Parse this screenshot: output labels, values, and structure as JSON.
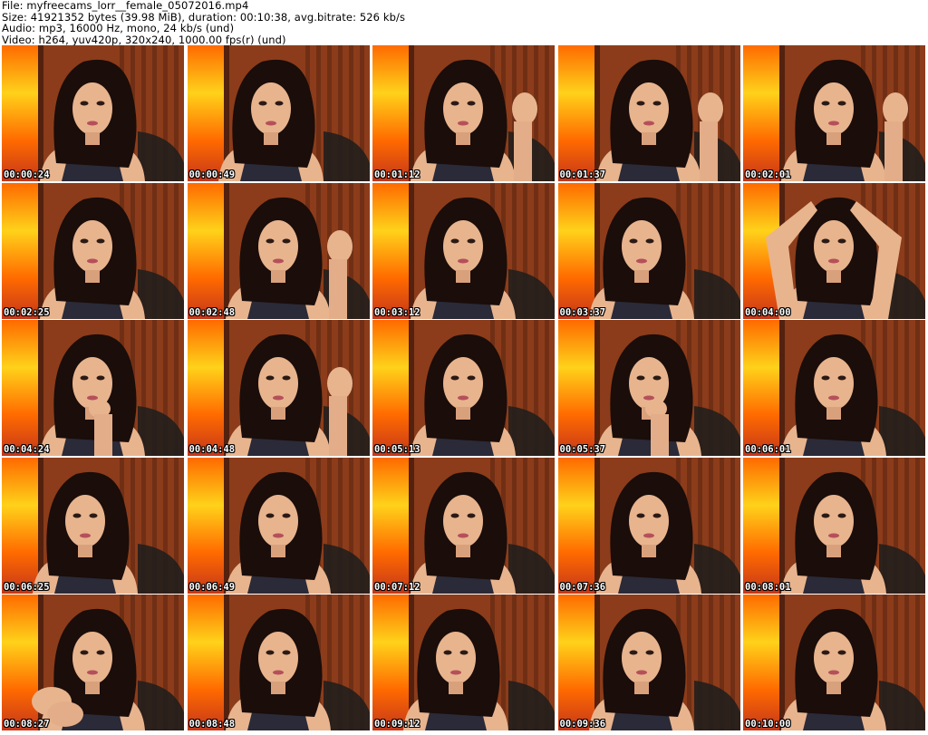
{
  "header": {
    "file": "File: myfreecams_lorr__female_05072016.mp4",
    "size": "Size: 41921352 bytes (39.98 MiB), duration: 00:10:38, avg.bitrate: 526 kb/s",
    "audio": "Audio: mp3, 16000 Hz, mono, 24 kb/s (und)",
    "video": "Video: h264, yuv420p, 320x240, 1000.00 fps(r) (und)"
  },
  "colors": {
    "background": "#ffffff",
    "header_text": "#000000",
    "timestamp_text": "#ffffff",
    "lamp_bright": "#ffd21a",
    "lamp_mid": "#ff6a00",
    "wall_red": "#c4361a",
    "curtain_brown": "#7a3518",
    "hair": "#1a0d0a",
    "skin": "#e8b48e"
  },
  "thumbnails": [
    {
      "timestamp": "00:00:24",
      "pose": "center"
    },
    {
      "timestamp": "00:00:49",
      "pose": "tilt-left"
    },
    {
      "timestamp": "00:01:12",
      "pose": "hand-up"
    },
    {
      "timestamp": "00:01:37",
      "pose": "hand-up"
    },
    {
      "timestamp": "00:02:01",
      "pose": "hand-up"
    },
    {
      "timestamp": "00:02:25",
      "pose": "center"
    },
    {
      "timestamp": "00:02:48",
      "pose": "hand-up"
    },
    {
      "timestamp": "00:03:12",
      "pose": "center"
    },
    {
      "timestamp": "00:03:37",
      "pose": "tilt-left"
    },
    {
      "timestamp": "00:04:00",
      "pose": "arms-up"
    },
    {
      "timestamp": "00:04:24",
      "pose": "hand-chin"
    },
    {
      "timestamp": "00:04:48",
      "pose": "hand-up"
    },
    {
      "timestamp": "00:05:13",
      "pose": "center"
    },
    {
      "timestamp": "00:05:37",
      "pose": "hand-chin"
    },
    {
      "timestamp": "00:06:01",
      "pose": "center"
    },
    {
      "timestamp": "00:06:25",
      "pose": "tilt-left"
    },
    {
      "timestamp": "00:06:49",
      "pose": "center"
    },
    {
      "timestamp": "00:07:12",
      "pose": "center"
    },
    {
      "timestamp": "00:07:36",
      "pose": "center"
    },
    {
      "timestamp": "00:08:01",
      "pose": "center"
    },
    {
      "timestamp": "00:08:27",
      "pose": "hands-front"
    },
    {
      "timestamp": "00:08:48",
      "pose": "center"
    },
    {
      "timestamp": "00:09:12",
      "pose": "tilt-left"
    },
    {
      "timestamp": "00:09:36",
      "pose": "tilt-left"
    },
    {
      "timestamp": "00:10:00",
      "pose": "center"
    }
  ]
}
